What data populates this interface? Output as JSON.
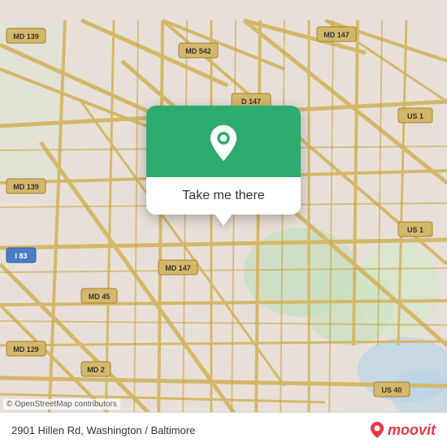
{
  "map": {
    "background_color": "#e8e0d8",
    "center_lat": 39.31,
    "center_lng": -76.59
  },
  "popup": {
    "button_label": "Take me there",
    "icon_name": "location-pin-icon",
    "background_color": "#2eab6e"
  },
  "bottom_bar": {
    "address": "2901 Hillen Rd, Washington / Baltimore",
    "logo_text": "moovit",
    "attribution": "© OpenStreetMap contributors"
  },
  "road_badges": [
    "MD 139",
    "MD 542",
    "MD 147",
    "US 1",
    "MD 139",
    "I 83",
    "MD 45",
    "MD 147",
    "US 1",
    "MD 129",
    "MD 2",
    "US 40"
  ]
}
